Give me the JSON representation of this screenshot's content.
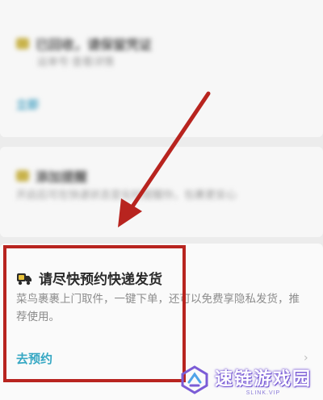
{
  "blurred_top": {
    "title": "已回收，请保留凭证",
    "subtitle": "运单号·查看详情",
    "link": "立即"
  },
  "blurred_mid": {
    "title": "添加提醒",
    "subtitle": "开启后可在快递状态变化时提醒你，包裹更安心"
  },
  "card": {
    "title": "请尽快预约快递发货",
    "description": "菜鸟裹裹上门取件，一键下单，还可以免费享隐私发货，推荐使用。",
    "action_label": "去预约",
    "chevron": "›"
  },
  "icons": {
    "truck": "truck-icon",
    "arrow": "arrow-icon"
  },
  "colors": {
    "highlight_border": "#b8241f",
    "link": "#35a7c3",
    "truck": "#2b2b2b",
    "truck_accent": "#e8c23a"
  },
  "watermark": {
    "text": "速链游戏园",
    "sub": "SLINK.VIP"
  }
}
